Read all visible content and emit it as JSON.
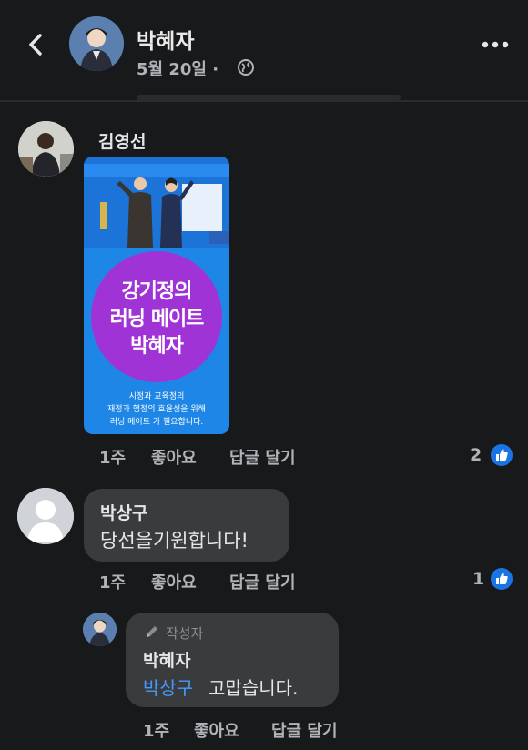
{
  "header": {
    "name": "박혜자",
    "date": "5월 20일 ·"
  },
  "comments": [
    {
      "author": "김영선",
      "poster": {
        "line1": "강기정의",
        "line2": "러닝 메이트",
        "line3": "박혜자",
        "small1": "시정과 교육정의",
        "small2": "재정과 행정의 효율성을 위해",
        "small3": "러닝 메이트 가 필요합니다."
      },
      "time": "1주",
      "like_label": "좋아요",
      "reply_label": "답글 달기",
      "reaction_count": "2"
    },
    {
      "author": "박상구",
      "text": "당선을기원합니다!",
      "time": "1주",
      "like_label": "좋아요",
      "reply_label": "답글 달기",
      "reaction_count": "1"
    },
    {
      "author_badge": "작성자",
      "author": "박혜자",
      "mention": "박상구",
      "text": "고맙습니다.",
      "time": "1주",
      "like_label": "좋아요",
      "reply_label": "답글 달기"
    }
  ],
  "colors": {
    "background": "#18191b",
    "bubble": "#3a3b3c",
    "mention": "#4599ff",
    "like": "#1b74e4",
    "poster_blue": "#1e86e6",
    "poster_purple": "#a033d6"
  },
  "icons": [
    "back-icon",
    "globe-icon",
    "more-icon",
    "like-icon",
    "pen-icon"
  ]
}
